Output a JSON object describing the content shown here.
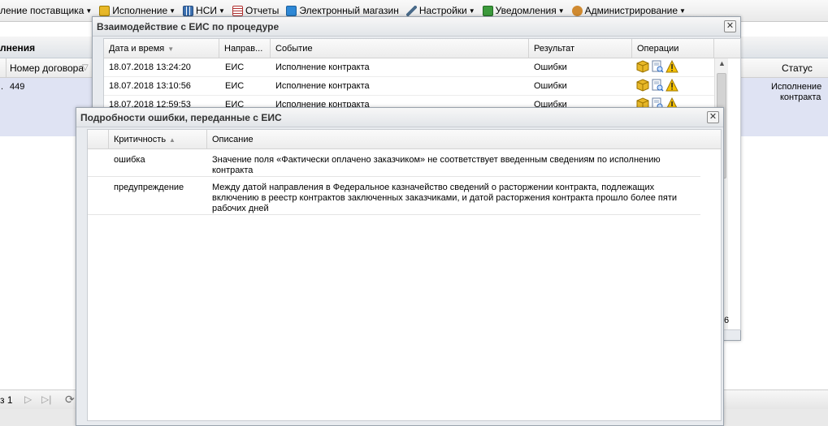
{
  "menu": {
    "items": [
      {
        "label": "ление поставщика",
        "icon": "none",
        "color": ""
      },
      {
        "label": "Исполнение",
        "icon": "execution-icon",
        "color": "#d9a200"
      },
      {
        "label": "НСИ",
        "icon": "nsi-icon",
        "color": "#3a6fb0"
      },
      {
        "label": "Отчеты",
        "icon": "reports-icon",
        "color": "#b03030"
      },
      {
        "label": "Электронный магазин",
        "icon": "shop-icon",
        "color": "#2e88d6"
      },
      {
        "label": "Настройки",
        "icon": "settings-icon",
        "color": "#4a6b8a"
      },
      {
        "label": "Уведомления",
        "icon": "notifications-icon",
        "color": "#3c9a3c"
      },
      {
        "label": "Администрирование",
        "icon": "admin-icon",
        "color": "#d08a30"
      }
    ]
  },
  "background": {
    "panel_title": "лнения",
    "col_contract": "Номер договора",
    "col_status": "Статус",
    "row_contract": "449",
    "row_status_line1": "Исполнение",
    "row_status_line2": "контракта",
    "pager_text": "з 1",
    "side_digit": "6"
  },
  "eis_window": {
    "title": "Взаимодействие с ЕИС по процедуре",
    "columns": {
      "datetime": "Дата и время",
      "direction": "Направ...",
      "event": "Событие",
      "result": "Результат",
      "operations": "Операции"
    },
    "rows": [
      {
        "datetime": "18.07.2018 13:24:20",
        "direction": "ЕИС",
        "event": "Исполнение контракта",
        "result": "Ошибки"
      },
      {
        "datetime": "18.07.2018 13:10:56",
        "direction": "ЕИС",
        "event": "Исполнение контракта",
        "result": "Ошибки"
      },
      {
        "datetime": "18.07.2018 12:59:53",
        "direction": "ЕИС",
        "event": "Исполнение контракта",
        "result": "Ошибки"
      }
    ]
  },
  "error_window": {
    "title": "Подробности ошибки, переданные с ЕИС",
    "columns": {
      "criticality": "Критичность",
      "description": "Описание"
    },
    "rows": [
      {
        "criticality": "ошибка",
        "desc_line1": "Значение поля «Фактически оплачено заказчиком» не соответствует введенным сведениям по исполнению",
        "desc_line2": "контракта",
        "desc_line3": ""
      },
      {
        "criticality": "предупреждение",
        "desc_line1": "Между датой направления в Федеральное казначейство сведений о расторжении контракта, подлежащих",
        "desc_line2": "включению в реестр контрактов заключенных заказчиками, и датой расторжения контракта прошло более пяти",
        "desc_line3": "рабочих дней"
      }
    ]
  }
}
